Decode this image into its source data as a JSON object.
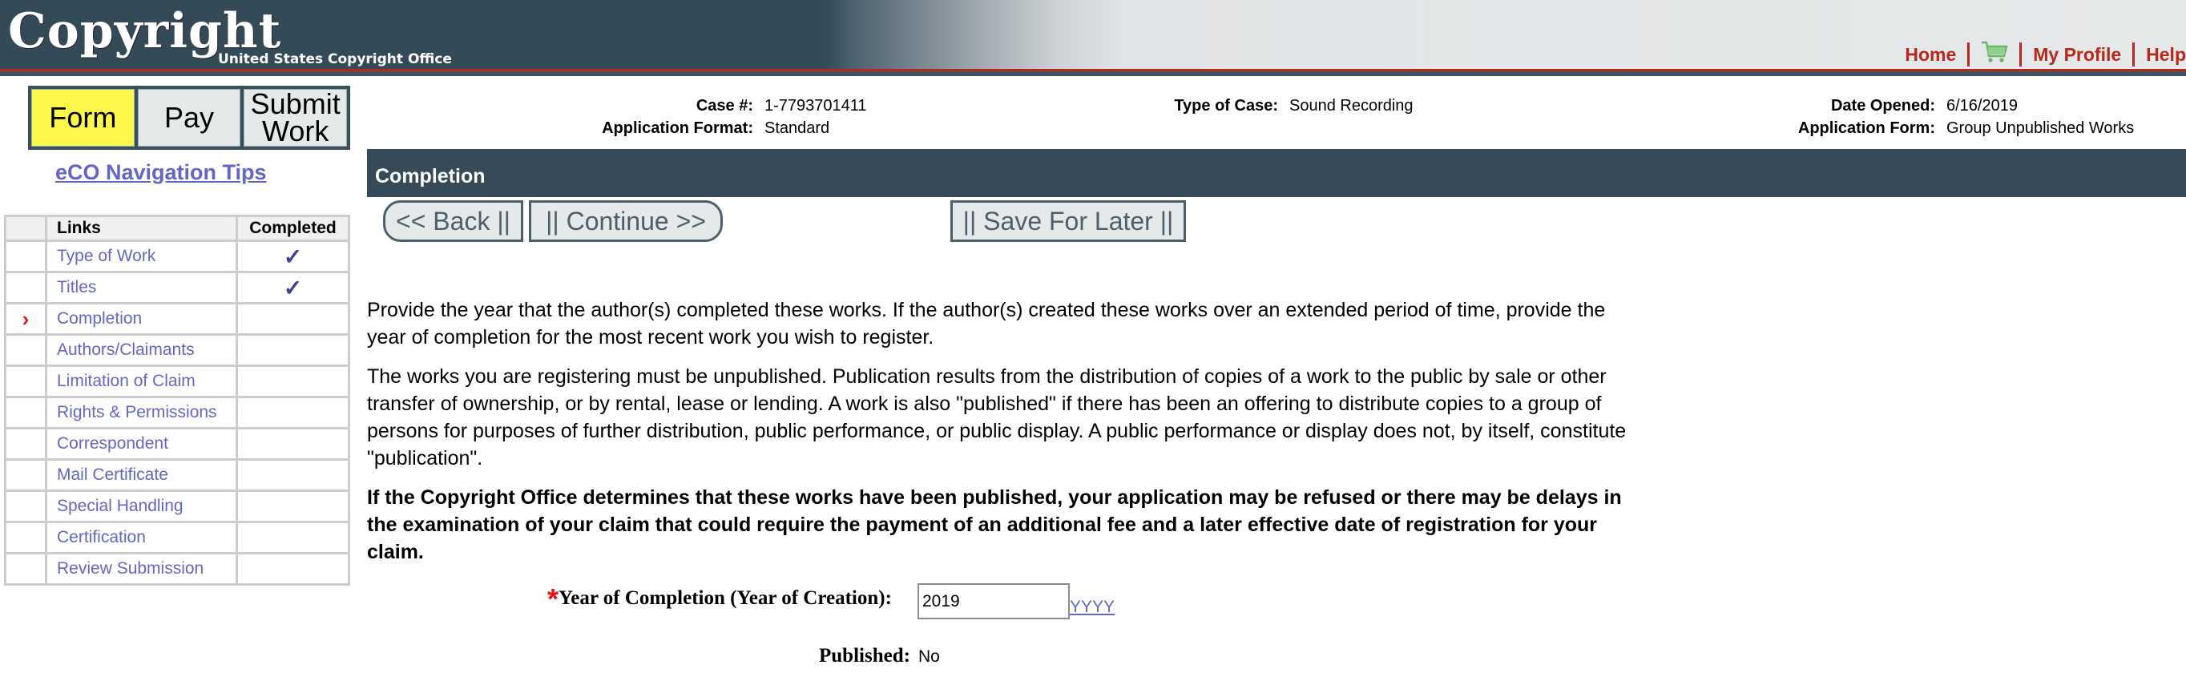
{
  "header": {
    "logo_title": "Copyright",
    "logo_subtitle": "United States Copyright Office",
    "nav": {
      "home": "Home",
      "cart_icon": "shopping-cart-icon",
      "my_profile": "My Profile",
      "help": "Help"
    },
    "colors": {
      "banner": "#344a57",
      "accent_red": "#b8261c"
    }
  },
  "phase_tabs": [
    {
      "label": "Form",
      "active": true
    },
    {
      "label": "Pay",
      "active": false
    },
    {
      "label": "Submit Work",
      "active": false
    }
  ],
  "nav_tips_link": "eCO Navigation Tips",
  "links_table": {
    "headers": [
      "",
      "Links",
      "Completed"
    ],
    "rows": [
      {
        "label": "Type of Work",
        "completed": "✓",
        "current": ""
      },
      {
        "label": "Titles",
        "completed": "✓",
        "current": ""
      },
      {
        "label": "Completion",
        "completed": "",
        "current": "›"
      },
      {
        "label": "Authors/Claimants",
        "completed": "",
        "current": ""
      },
      {
        "label": "Limitation of Claim",
        "completed": "",
        "current": ""
      },
      {
        "label": "Rights & Permissions",
        "completed": "",
        "current": ""
      },
      {
        "label": "Correspondent",
        "completed": "",
        "current": ""
      },
      {
        "label": "Mail Certificate",
        "completed": "",
        "current": ""
      },
      {
        "label": "Special Handling",
        "completed": "",
        "current": ""
      },
      {
        "label": "Certification",
        "completed": "",
        "current": ""
      },
      {
        "label": "Review Submission",
        "completed": "",
        "current": ""
      }
    ]
  },
  "case_info": {
    "case_number_label": "Case #:",
    "case_number": "1-7793701411",
    "app_format_label": "Application Format:",
    "app_format": "Standard",
    "type_of_case_label": "Type of Case:",
    "type_of_case": "Sound Recording",
    "date_opened_label": "Date Opened:",
    "date_opened": "6/16/2019",
    "app_form_label": "Application Form:",
    "app_form": "Group Unpublished Works"
  },
  "section": {
    "title": "Completion",
    "buttons": {
      "back": "<< Back ||",
      "continue": "|| Continue >>",
      "save": "|| Save For Later ||"
    },
    "paragraphs": [
      "Provide the year that the author(s) completed these works. If the author(s) created these works over an extended period of time, provide the year of completion for the most recent work you wish to register.",
      "The works you are registering must be unpublished. Publication results from the distribution of copies of a work to the public by sale or other transfer of ownership, or by rental, lease or lending. A work is also \"published\" if there has been an offering to distribute copies to a group of persons for purposes of further distribution, public performance, or public display. A public performance or display does not, by itself, constitute \"publication\".",
      "If the Copyright Office determines that these works have been published, your application may be refused or there may be delays in the examination of your claim that could require the payment of an additional fee and a later effective date of registration for your claim."
    ],
    "form": {
      "required_mark": "*",
      "year_label": "Year of Completion (Year of Creation):",
      "year_value": "2019",
      "year_format_hint": "YYYY",
      "published_label": "Published:",
      "published_value": "No"
    }
  }
}
